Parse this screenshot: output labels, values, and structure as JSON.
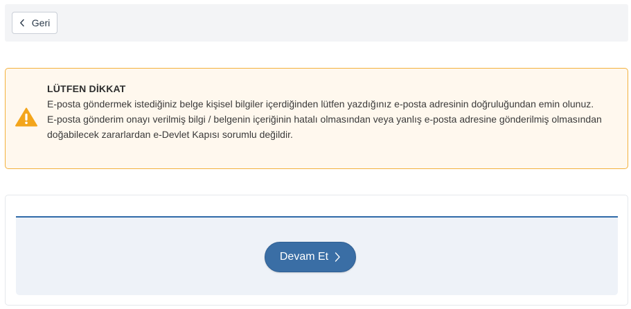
{
  "toolbar": {
    "back_label": "Geri",
    "back_icon": "chevron-left-icon"
  },
  "alert": {
    "icon": "warning-icon",
    "accent_color": "#f3a51b",
    "title": "LÜTFEN DİKKAT",
    "message_1": "E-posta göndermek istediğiniz belge kişisel bilgiler içerdiğinden lütfen yazdığınız e-posta adresinin doğruluğundan emin olunuz.",
    "message_2": "E-posta gönderim onayı verilmiş bilgi / belgenin içeriğinin hatalı olmasından veya yanlış e-posta adresine gönderilmiş olmasından doğabilecek zararlardan e-Devlet Kapısı sorumlu değildir."
  },
  "actions": {
    "continue_label": "Devam Et",
    "continue_icon": "chevron-right-icon",
    "primary_color": "#3a6ea5"
  }
}
